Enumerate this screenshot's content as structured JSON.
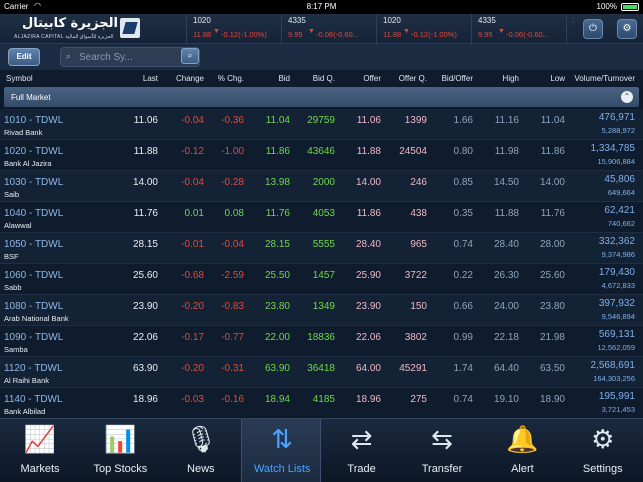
{
  "statusbar": {
    "carrier": "Carrier",
    "time": "8:17 PM",
    "battery": "100%"
  },
  "app": {
    "logo_ar": "الجزيرة كابيتال",
    "logo_en": "ALJAZIRA CAPITAL الجزيرة للأسواق المالية"
  },
  "ticker": [
    {
      "sym": "1020",
      "price": "11.88",
      "chg": "-0.12(-1.00%)"
    },
    {
      "sym": "4335",
      "price": "9.95",
      "chg": "-0.06(-0.60..."
    },
    {
      "sym": "1020",
      "price": "11.88",
      "chg": "-0.12(-1.00%)"
    },
    {
      "sym": "4335",
      "price": "9.95",
      "chg": "-0.06(-0.60..."
    },
    {
      "sym": "10",
      "price": "11",
      "chg": ""
    }
  ],
  "toolbar": {
    "edit_label": "Edit",
    "search_placeholder": "Search Sy..."
  },
  "columns": {
    "symbol": "Symbol",
    "last": "Last",
    "change": "Change",
    "pct": "% Chg.",
    "bid": "Bid",
    "bidq": "Bid Q.",
    "offer": "Offer",
    "offerq": "Offer Q.",
    "bo": "Bid/Offer",
    "high": "High",
    "low": "Low",
    "vol": "Volume/Turnover"
  },
  "group": {
    "label": "Full Market"
  },
  "rows": [
    {
      "sym": "1010 - TDWL",
      "name": "Rivad Bank",
      "last": "11.06",
      "change": "-0.04",
      "pct": "-0.36",
      "bid": "11.04",
      "bidq": "29759",
      "offer": "11.06",
      "offerq": "1399",
      "bo": "1.66",
      "high": "11.16",
      "low": "11.04",
      "vol": "476,971",
      "turn": "5,288,972",
      "dir": "down"
    },
    {
      "sym": "1020 - TDWL",
      "name": "Bank Al Jazira",
      "last": "11.88",
      "change": "-0.12",
      "pct": "-1.00",
      "bid": "11.86",
      "bidq": "43646",
      "offer": "11.88",
      "offerq": "24504",
      "bo": "0.80",
      "high": "11.98",
      "low": "11.86",
      "vol": "1,334,785",
      "turn": "15,906,884",
      "dir": "down"
    },
    {
      "sym": "1030 - TDWL",
      "name": "Saib",
      "last": "14.00",
      "change": "-0.04",
      "pct": "-0.28",
      "bid": "13.98",
      "bidq": "2000",
      "offer": "14.00",
      "offerq": "246",
      "bo": "0.85",
      "high": "14.50",
      "low": "14.00",
      "vol": "45,806",
      "turn": "649,664",
      "dir": "down"
    },
    {
      "sym": "1040 - TDWL",
      "name": "Alawwal",
      "last": "11.76",
      "change": "0.01",
      "pct": "0.08",
      "bid": "11.76",
      "bidq": "4053",
      "offer": "11.86",
      "offerq": "438",
      "bo": "0.35",
      "high": "11.88",
      "low": "11.76",
      "vol": "62,421",
      "turn": "740,662",
      "dir": "up"
    },
    {
      "sym": "1050 - TDWL",
      "name": "BSF",
      "last": "28.15",
      "change": "-0.01",
      "pct": "-0.04",
      "bid": "28.15",
      "bidq": "5555",
      "offer": "28.40",
      "offerq": "965",
      "bo": "0.74",
      "high": "28.40",
      "low": "28.00",
      "vol": "332,362",
      "turn": "9,374,986",
      "dir": "down"
    },
    {
      "sym": "1060 - TDWL",
      "name": "Sabb",
      "last": "25.60",
      "change": "-0.68",
      "pct": "-2.59",
      "bid": "25.50",
      "bidq": "1457",
      "offer": "25.90",
      "offerq": "3722",
      "bo": "0.22",
      "high": "26.30",
      "low": "25.60",
      "vol": "179,430",
      "turn": "4,672,833",
      "dir": "down"
    },
    {
      "sym": "1080 - TDWL",
      "name": "Arab National Bank",
      "last": "23.90",
      "change": "-0.20",
      "pct": "-0.83",
      "bid": "23.80",
      "bidq": "1349",
      "offer": "23.90",
      "offerq": "150",
      "bo": "0.66",
      "high": "24.00",
      "low": "23.80",
      "vol": "397,932",
      "turn": "9,546,894",
      "dir": "down"
    },
    {
      "sym": "1090 - TDWL",
      "name": "Samba",
      "last": "22.06",
      "change": "-0.17",
      "pct": "-0.77",
      "bid": "22.00",
      "bidq": "18836",
      "offer": "22.06",
      "offerq": "3802",
      "bo": "0.99",
      "high": "22.18",
      "low": "21.98",
      "vol": "569,131",
      "turn": "12,562,059",
      "dir": "down"
    },
    {
      "sym": "1120 - TDWL",
      "name": "Al Raihi Bank",
      "last": "63.90",
      "change": "-0.20",
      "pct": "-0.31",
      "bid": "63.90",
      "bidq": "36418",
      "offer": "64.00",
      "offerq": "45291",
      "bo": "1.74",
      "high": "64.40",
      "low": "63.50",
      "vol": "2,568,691",
      "turn": "164,303,256",
      "dir": "down"
    },
    {
      "sym": "1140 - TDWL",
      "name": "Bank Albilad",
      "last": "18.96",
      "change": "-0.03",
      "pct": "-0.16",
      "bid": "18.94",
      "bidq": "4185",
      "offer": "18.96",
      "offerq": "275",
      "bo": "0.74",
      "high": "19.10",
      "low": "18.90",
      "vol": "195,991",
      "turn": "3,721,453",
      "dir": "down"
    }
  ],
  "tabs": [
    {
      "label": "Markets",
      "icon": "markets-chart-icon"
    },
    {
      "label": "Top Stocks",
      "icon": "bar-chart-icon"
    },
    {
      "label": "News",
      "icon": "microphone-icon"
    },
    {
      "label": "Watch Lists",
      "icon": "sort-arrows-icon",
      "active": true
    },
    {
      "label": "Trade",
      "icon": "trade-exchange-icon"
    },
    {
      "label": "Transfer",
      "icon": "transfer-arrows-icon"
    },
    {
      "label": "Alert",
      "icon": "bell-icon"
    },
    {
      "label": "Settings",
      "icon": "gear-icon"
    }
  ]
}
